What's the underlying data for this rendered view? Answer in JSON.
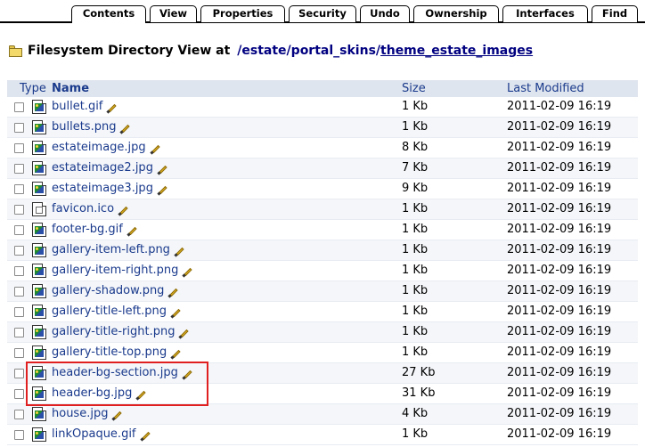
{
  "tabs": [
    "Contents",
    "View",
    "Properties",
    "Security",
    "Undo",
    "Ownership",
    "Interfaces",
    "Find"
  ],
  "active_tab": "Contents",
  "header": {
    "label": "Filesystem Directory View at",
    "path_sep": "/",
    "path": [
      "estate",
      "portal_skins",
      "theme_estate_images"
    ]
  },
  "columns": {
    "type": "Type",
    "name": "Name",
    "size": "Size",
    "modified": "Last Modified"
  },
  "files": [
    {
      "name": "bullet.gif",
      "size": "1 Kb",
      "modified": "2011-02-09 16:19",
      "icon": "image-icon"
    },
    {
      "name": "bullets.png",
      "size": "1 Kb",
      "modified": "2011-02-09 16:19",
      "icon": "image-icon"
    },
    {
      "name": "estateimage.jpg",
      "size": "8 Kb",
      "modified": "2011-02-09 16:19",
      "icon": "image-icon"
    },
    {
      "name": "estateimage2.jpg",
      "size": "7 Kb",
      "modified": "2011-02-09 16:19",
      "icon": "image-icon"
    },
    {
      "name": "estateimage3.jpg",
      "size": "9 Kb",
      "modified": "2011-02-09 16:19",
      "icon": "image-icon"
    },
    {
      "name": "favicon.ico",
      "size": "1 Kb",
      "modified": "2011-02-09 16:19",
      "icon": "file-icon"
    },
    {
      "name": "footer-bg.gif",
      "size": "1 Kb",
      "modified": "2011-02-09 16:19",
      "icon": "image-icon"
    },
    {
      "name": "gallery-item-left.png",
      "size": "1 Kb",
      "modified": "2011-02-09 16:19",
      "icon": "image-icon"
    },
    {
      "name": "gallery-item-right.png",
      "size": "1 Kb",
      "modified": "2011-02-09 16:19",
      "icon": "image-icon"
    },
    {
      "name": "gallery-shadow.png",
      "size": "1 Kb",
      "modified": "2011-02-09 16:19",
      "icon": "image-icon"
    },
    {
      "name": "gallery-title-left.png",
      "size": "1 Kb",
      "modified": "2011-02-09 16:19",
      "icon": "image-icon"
    },
    {
      "name": "gallery-title-right.png",
      "size": "1 Kb",
      "modified": "2011-02-09 16:19",
      "icon": "image-icon"
    },
    {
      "name": "gallery-title-top.png",
      "size": "1 Kb",
      "modified": "2011-02-09 16:19",
      "icon": "image-icon"
    },
    {
      "name": "header-bg-section.jpg",
      "size": "27 Kb",
      "modified": "2011-02-09 16:19",
      "icon": "image-icon"
    },
    {
      "name": "header-bg.jpg",
      "size": "31 Kb",
      "modified": "2011-02-09 16:19",
      "icon": "image-icon"
    },
    {
      "name": "house.jpg",
      "size": "4 Kb",
      "modified": "2011-02-09 16:19",
      "icon": "image-icon"
    },
    {
      "name": "linkOpaque.gif",
      "size": "1 Kb",
      "modified": "2011-02-09 16:19",
      "icon": "image-icon"
    }
  ],
  "colors": {
    "link": "#1a3a8c",
    "header_bg": "#dfe5ee",
    "highlight": "#e02020"
  }
}
